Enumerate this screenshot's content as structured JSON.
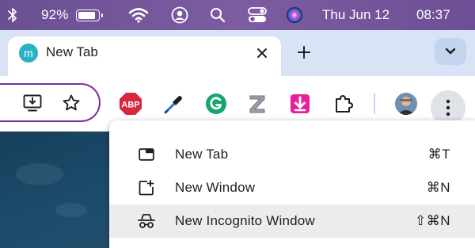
{
  "menubar": {
    "icons": [
      "bluetooth-icon",
      "battery-icon",
      "wifi-icon",
      "user-icon",
      "search-icon",
      "control-center-icon",
      "siri-icon"
    ],
    "battery_percent": "92%",
    "battery_level": 0.92,
    "day_date": "Thu Jun 12",
    "time": "08:37"
  },
  "tab": {
    "favicon_letter": "m",
    "title": "New Tab"
  },
  "toolbar": {
    "extensions": [
      "install-app-icon",
      "bookmark-star-icon",
      "adblock-plus-icon",
      "color-picker-icon",
      "grammarly-icon",
      "z-extension-icon",
      "download-extension-icon",
      "extensions-puzzle-icon",
      "profile-avatar-icon"
    ],
    "adblock_label": "ABP"
  },
  "menu": {
    "items": [
      {
        "label": "New Tab",
        "shortcut": "⌘T",
        "icon": "new-tab-icon"
      },
      {
        "label": "New Window",
        "shortcut": "⌘N",
        "icon": "new-window-icon"
      },
      {
        "label": "New Incognito Window",
        "shortcut": "⇧⌘N",
        "icon": "incognito-icon"
      }
    ]
  },
  "colors": {
    "menubar_bg": "#6d4f95",
    "tabstrip_bg": "#d8e4f6",
    "omnibox_border": "#7e2c9c",
    "favicon_bg": "#27b3c5",
    "menu_hover": "#ececec",
    "abp_red": "#d7263d",
    "download_pink": "#e91e9a"
  }
}
